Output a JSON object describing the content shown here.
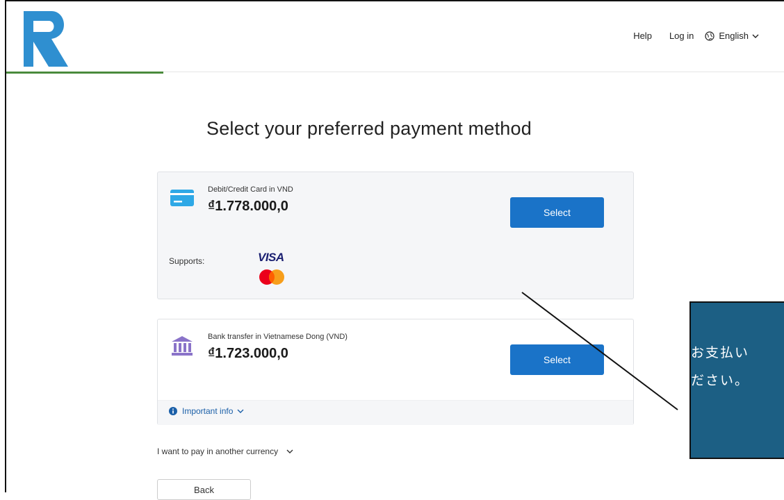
{
  "header": {
    "nav": {
      "help": "Help",
      "login": "Log in",
      "language": "English"
    }
  },
  "page_title": "Select your preferred payment method",
  "methods": [
    {
      "name": "Debit/Credit Card in VND",
      "amount": "₫1.778.000,0",
      "select_label": "Select",
      "supports_label": "Supports:",
      "card_brands": [
        "VISA",
        "Mastercard"
      ]
    },
    {
      "name": "Bank transfer in Vietnamese Dong (VND)",
      "amount": "₫1.723.000,0",
      "select_label": "Select",
      "info_label": "Important info"
    }
  ],
  "other_currency": "I want to pay in another currency",
  "back_label": "Back",
  "callout": {
    "text": "お支払い\nださい。"
  },
  "colors": {
    "primary_button": "#1a73c8",
    "callout_bg": "#1c5f84",
    "logo_blue": "#2f8fd0",
    "accent_green": "#4a8a3c"
  }
}
